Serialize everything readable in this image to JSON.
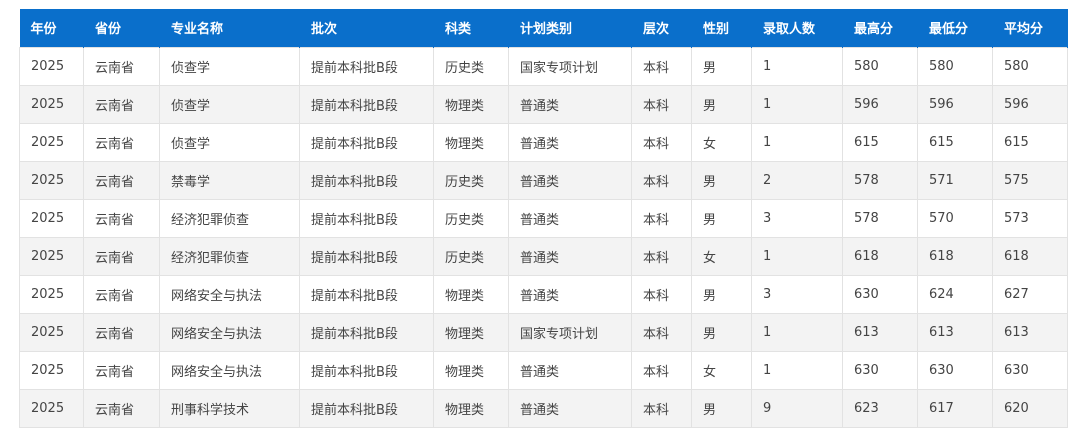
{
  "table": {
    "headers": [
      "年份",
      "省份",
      "专业名称",
      "批次",
      "科类",
      "计划类别",
      "层次",
      "性别",
      "录取人数",
      "最高分",
      "最低分",
      "平均分"
    ],
    "rows": [
      [
        "2025",
        "云南省",
        "侦查学",
        "提前本科批B段",
        "历史类",
        "国家专项计划",
        "本科",
        "男",
        "1",
        "580",
        "580",
        "580"
      ],
      [
        "2025",
        "云南省",
        "侦查学",
        "提前本科批B段",
        "物理类",
        "普通类",
        "本科",
        "男",
        "1",
        "596",
        "596",
        "596"
      ],
      [
        "2025",
        "云南省",
        "侦查学",
        "提前本科批B段",
        "物理类",
        "普通类",
        "本科",
        "女",
        "1",
        "615",
        "615",
        "615"
      ],
      [
        "2025",
        "云南省",
        "禁毒学",
        "提前本科批B段",
        "历史类",
        "普通类",
        "本科",
        "男",
        "2",
        "578",
        "571",
        "575"
      ],
      [
        "2025",
        "云南省",
        "经济犯罪侦查",
        "提前本科批B段",
        "历史类",
        "普通类",
        "本科",
        "男",
        "3",
        "578",
        "570",
        "573"
      ],
      [
        "2025",
        "云南省",
        "经济犯罪侦查",
        "提前本科批B段",
        "历史类",
        "普通类",
        "本科",
        "女",
        "1",
        "618",
        "618",
        "618"
      ],
      [
        "2025",
        "云南省",
        "网络安全与执法",
        "提前本科批B段",
        "物理类",
        "普通类",
        "本科",
        "男",
        "3",
        "630",
        "624",
        "627"
      ],
      [
        "2025",
        "云南省",
        "网络安全与执法",
        "提前本科批B段",
        "物理类",
        "国家专项计划",
        "本科",
        "男",
        "1",
        "613",
        "613",
        "613"
      ],
      [
        "2025",
        "云南省",
        "网络安全与执法",
        "提前本科批B段",
        "物理类",
        "普通类",
        "本科",
        "女",
        "1",
        "630",
        "630",
        "630"
      ],
      [
        "2025",
        "云南省",
        "刑事科学技术",
        "提前本科批B段",
        "物理类",
        "普通类",
        "本科",
        "男",
        "9",
        "623",
        "617",
        "620"
      ]
    ]
  },
  "colors": {
    "header_bg": "#0a6fcb",
    "header_text": "#ffffff",
    "row_alt": "#f3f3f3",
    "cell_text": "#444444"
  }
}
